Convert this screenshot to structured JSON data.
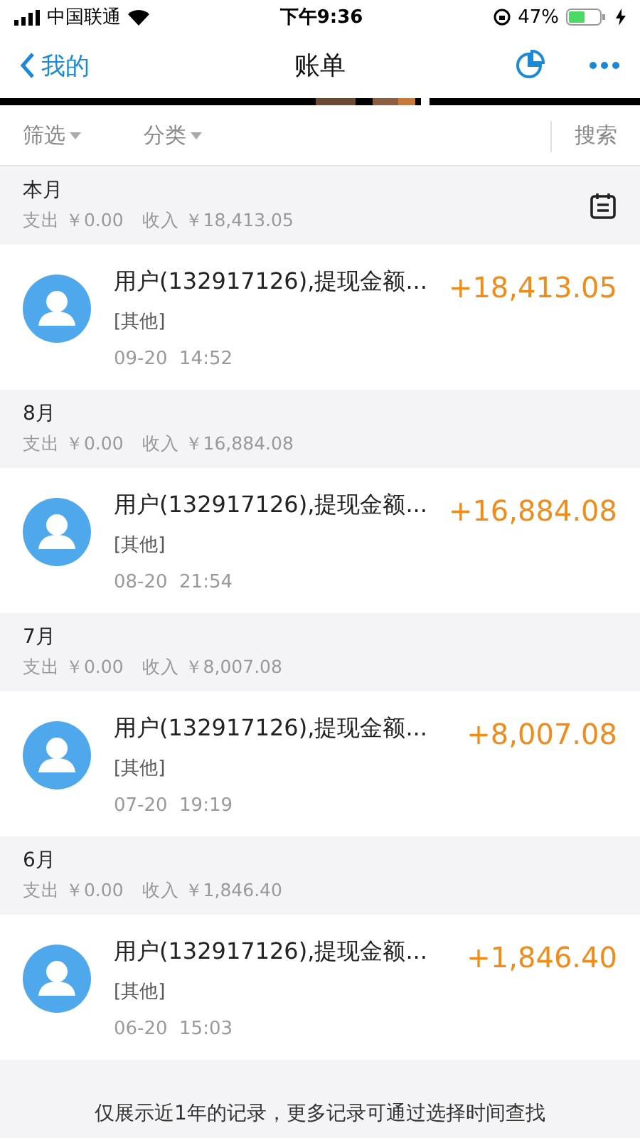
{
  "status_bar": {
    "carrier": "中国联通",
    "time": "下午9:36",
    "battery": "47%"
  },
  "nav": {
    "back": "我的",
    "title": "账单"
  },
  "filters": [
    {
      "label": "筛选"
    },
    {
      "label": "分类"
    }
  ],
  "search": "搜索",
  "months": [
    {
      "title": "本月",
      "summary": "支出 ￥0.00　收入 ￥18,413.05",
      "show_calendar": true,
      "items": [
        {
          "title": "用户(132917126),提现金额...",
          "category": "[其他]",
          "time": "09-20  14:52",
          "amount": "+18,413.05"
        }
      ]
    },
    {
      "title": "8月",
      "summary": "支出 ￥0.00　收入 ￥16,884.08",
      "show_calendar": false,
      "items": [
        {
          "title": "用户(132917126),提现金额...",
          "category": "[其他]",
          "time": "08-20  21:54",
          "amount": "+16,884.08"
        }
      ]
    },
    {
      "title": "7月",
      "summary": "支出 ￥0.00　收入 ￥8,007.08",
      "show_calendar": false,
      "items": [
        {
          "title": "用户(132917126),提现金额...",
          "category": "[其他]",
          "time": "07-20  19:19",
          "amount": "+8,007.08"
        }
      ]
    },
    {
      "title": "6月",
      "summary": "支出 ￥0.00　收入 ￥1,846.40",
      "show_calendar": false,
      "items": [
        {
          "title": "用户(132917126),提现金额...",
          "category": "[其他]",
          "time": "06-20  15:03",
          "amount": "+1,846.40"
        }
      ]
    }
  ],
  "footer": "仅展示近1年的记录，更多记录可通过选择时间查找"
}
